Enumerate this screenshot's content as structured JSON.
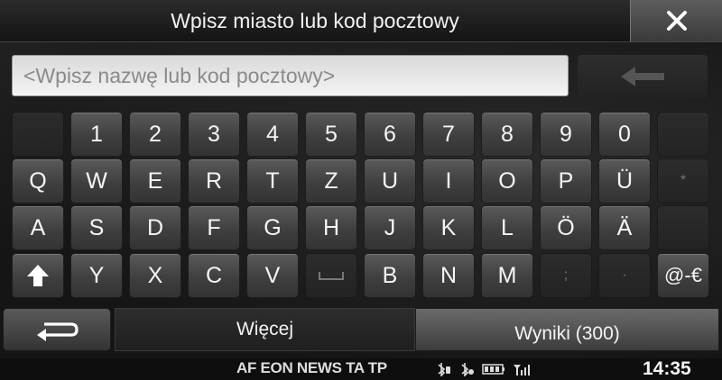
{
  "header": {
    "title": "Wpisz miasto lub kod pocztowy",
    "close_icon": "close-icon"
  },
  "search": {
    "placeholder": "<Wpisz nazwę lub kod pocztowy>",
    "value": ""
  },
  "backspace_icon": "backspace-arrow-icon",
  "keyboard": {
    "row1": [
      "",
      "1",
      "2",
      "3",
      "4",
      "5",
      "6",
      "7",
      "8",
      "9",
      "0",
      ""
    ],
    "row2": [
      "Q",
      "W",
      "E",
      "R",
      "T",
      "Z",
      "U",
      "I",
      "O",
      "P",
      "Ü",
      "*"
    ],
    "row3": [
      "A",
      "S",
      "D",
      "F",
      "G",
      "H",
      "J",
      "K",
      "L",
      "Ö",
      "Ä",
      ""
    ],
    "row4": [
      "shift",
      "Y",
      "X",
      "C",
      "V",
      "␣",
      "B",
      "N",
      "M",
      ";",
      "·",
      "@-€"
    ]
  },
  "bottom": {
    "back_icon": "return-arrow-icon",
    "more_label": "Więcej",
    "results_label": "Wyniki (300)"
  },
  "status": {
    "indicators": "AF EON NEWS TA TP",
    "icons": [
      "bluetooth-phone-icon",
      "bluetooth-audio-icon",
      "battery-icon",
      "signal-icon"
    ],
    "time": "14:35"
  },
  "colors": {
    "key_active": "#4a4a4a",
    "key_disabled": "#282828",
    "input_bg": "#eeeeee",
    "topbar": "#1e1e1e"
  }
}
